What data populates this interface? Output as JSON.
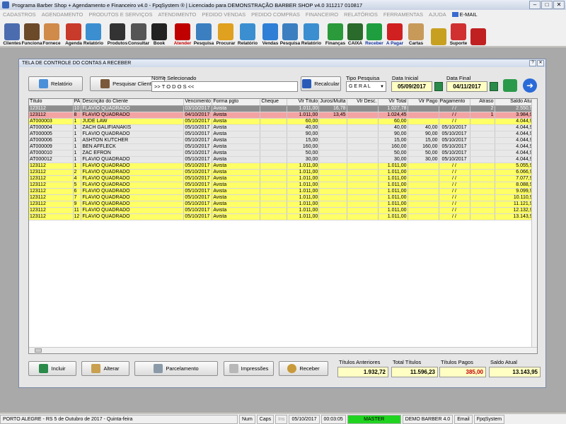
{
  "app": {
    "title": "Programa Barber Shop + Agendamento e Financeiro v4.0 - FpqSystem ® | Licenciado para  DEMONSTRAÇÃO BARBER SHOP v4.0 311217 010817"
  },
  "menu": [
    "CADASTROS",
    "AGENDAMENTO",
    "PRODUTOS E SERVIÇOS",
    "ATENDIMENTO",
    "PEDIDO VENDAS",
    "PEDIDO COMPRAS",
    "FINANCEIRO",
    "RELATÓRIOS",
    "FERRAMENTAS",
    "AJUDA"
  ],
  "menu_email": "E-MAIL",
  "toolbar": [
    {
      "label": "Clientes",
      "icon": "clients-icon",
      "color": "#4b6db0"
    },
    {
      "label": "Funciona",
      "icon": "employee-icon",
      "color": "#6b4a2a"
    },
    {
      "label": "Fornece",
      "icon": "supplier-icon",
      "color": "#d08a4a"
    },
    {
      "label": "Agenda",
      "icon": "schedule-icon",
      "color": "#c83a2a"
    },
    {
      "label": "Relatório",
      "icon": "report-icon",
      "color": "#3b8fd0"
    },
    {
      "label": "Produtos",
      "icon": "products-icon",
      "color": "#333333"
    },
    {
      "label": "Consultar",
      "icon": "consult-icon",
      "color": "#555555"
    },
    {
      "label": "Book",
      "icon": "camera-icon",
      "color": "#222222"
    },
    {
      "label": "Atender",
      "icon": "service-icon",
      "color": "#c00000"
    },
    {
      "label": "Pesquisa",
      "icon": "search-icon",
      "color": "#3b7fc0"
    },
    {
      "label": "Procurar",
      "icon": "folder-icon",
      "color": "#e0a020"
    },
    {
      "label": "Relatório",
      "icon": "report-icon",
      "color": "#3b8fd0"
    },
    {
      "label": "Vendas",
      "icon": "sales-icon",
      "color": "#2f7fd6"
    },
    {
      "label": "Pesquisa",
      "icon": "search-icon",
      "color": "#3b7fc0"
    },
    {
      "label": "Relatório",
      "icon": "report-icon",
      "color": "#3b8fd0"
    },
    {
      "label": "Finanças",
      "icon": "finance-icon",
      "color": "#2a9a3a"
    },
    {
      "label": "CAIXA",
      "icon": "cashbox-icon",
      "color": "#2a6a2a"
    },
    {
      "label": "Receber",
      "icon": "receive-icon",
      "color": "#1e9e3e"
    },
    {
      "label": "A Pagar",
      "icon": "pay-icon",
      "color": "#d02020"
    },
    {
      "label": "Cartas",
      "icon": "letters-icon",
      "color": "#c89a5a"
    },
    {
      "label": "",
      "icon": "coins-icon",
      "color": "#c8a020"
    },
    {
      "label": "Suporte",
      "icon": "support-icon",
      "color": "#d03030"
    },
    {
      "label": "",
      "icon": "exit-icon",
      "color": "#c02020"
    }
  ],
  "window": {
    "title": "TELA DE CONTROLE DO CONTAS A RECEBER",
    "relatorio_btn": "Relatório",
    "pesquisar_btn": "Pesquisar Cliente",
    "nome_label": "Nome Selecionado",
    "nome_value": ">> T O D O S <<",
    "recalcular_btn": "Recalcular",
    "tipo_label": "Tipo  Pesquisa",
    "tipo_value": "G E R A L",
    "data_inicial_label": "Data Inicial",
    "data_inicial": "05/09/2017",
    "data_final_label": "Data Final",
    "data_final": "04/11/2017"
  },
  "grid": {
    "columns": [
      "Título",
      "PA",
      "Descrição do Cliente",
      "Vencimento",
      "Forma pgto",
      "Cheque",
      "Vlr Título",
      "Juros/Multa",
      "Vlr Desc.",
      "Vlr Total",
      "Vlr Pago",
      "Pagamento",
      "Atraso",
      "Saldo Atual"
    ],
    "rows": [
      {
        "style": "gray",
        "cells": [
          "123112",
          "10",
          "FLÁVIO QUADRADO",
          "03/10/2017",
          "Avista",
          "",
          "1.011,00",
          "16,78",
          "",
          "1.027,78",
          "",
          "/  /",
          "2",
          "2.550,50"
        ]
      },
      {
        "style": "pink",
        "cells": [
          "123112",
          "8",
          "FLÁVIO QUADRADO",
          "04/10/2017",
          "Avista",
          "",
          "1.011,00",
          "13,45",
          "",
          "1.024,45",
          "",
          "/  /",
          "1",
          "3.984,95"
        ]
      },
      {
        "style": "yellow",
        "cells": [
          "AT000003",
          "1",
          "JUDE LAW",
          "05/10/2017",
          "Avista",
          "",
          "60,00",
          "",
          "",
          "60,00",
          "",
          "/  /",
          "",
          "4.044,95"
        ]
      },
      {
        "style": "white",
        "cells": [
          "AT000004",
          "1",
          "ZACH GALIFIANAKIS",
          "05/10/2017",
          "Avista",
          "",
          "40,00",
          "",
          "",
          "40,00",
          "40,00",
          "05/10/2017",
          "",
          "4.044,95"
        ]
      },
      {
        "style": "white",
        "cells": [
          "AT000005",
          "1",
          "FLÁVIO QUADRADO",
          "05/10/2017",
          "Avista",
          "",
          "90,00",
          "",
          "",
          "90,00",
          "90,00",
          "05/10/2017",
          "",
          "4.044,95"
        ]
      },
      {
        "style": "white",
        "cells": [
          "AT000006",
          "1",
          "ASHTON KUTCHER",
          "05/10/2017",
          "Avista",
          "",
          "15,00",
          "",
          "",
          "15,00",
          "15,00",
          "05/10/2017",
          "",
          "4.044,95"
        ]
      },
      {
        "style": "white",
        "cells": [
          "AT000009",
          "1",
          "BEN AFFLECK",
          "05/10/2017",
          "Avista",
          "",
          "160,00",
          "",
          "",
          "160,00",
          "160,00",
          "05/10/2017",
          "",
          "4.044,95"
        ]
      },
      {
        "style": "white",
        "cells": [
          "AT000010",
          "1",
          "ZAC EFRON",
          "05/10/2017",
          "Avista",
          "",
          "50,00",
          "",
          "",
          "50,00",
          "50,00",
          "05/10/2017",
          "",
          "4.044,95"
        ]
      },
      {
        "style": "white",
        "cells": [
          "AT000012",
          "1",
          "FLÁVIO QUADRADO",
          "05/10/2017",
          "Avista",
          "",
          "30,00",
          "",
          "",
          "30,00",
          "30,00",
          "05/10/2017",
          "",
          "4.044,95"
        ]
      },
      {
        "style": "yellow",
        "cells": [
          "123112",
          "1",
          "FLÁVIO QUADRADO",
          "05/10/2017",
          "Avista",
          "",
          "1.011,00",
          "",
          "",
          "1.011,00",
          "",
          "/  /",
          "",
          "5.055,95"
        ]
      },
      {
        "style": "yellow",
        "cells": [
          "123112",
          "2",
          "FLÁVIO QUADRADO",
          "05/10/2017",
          "Avista",
          "",
          "1.011,00",
          "",
          "",
          "1.011,00",
          "",
          "/  /",
          "",
          "6.066,95"
        ]
      },
      {
        "style": "yellow",
        "cells": [
          "123112",
          "4",
          "FLÁVIO QUADRADO",
          "05/10/2017",
          "Avista",
          "",
          "1.011,00",
          "",
          "",
          "1.011,00",
          "",
          "/  /",
          "",
          "7.077,95"
        ]
      },
      {
        "style": "yellow",
        "cells": [
          "123112",
          "5",
          "FLÁVIO QUADRADO",
          "05/10/2017",
          "Avista",
          "",
          "1.011,00",
          "",
          "",
          "1.011,00",
          "",
          "/  /",
          "",
          "8.088,95"
        ]
      },
      {
        "style": "yellow",
        "cells": [
          "123112",
          "6",
          "FLÁVIO QUADRADO",
          "05/10/2017",
          "Avista",
          "",
          "1.011,00",
          "",
          "",
          "1.011,00",
          "",
          "/  /",
          "",
          "9.099,95"
        ]
      },
      {
        "style": "yellow",
        "cells": [
          "123112",
          "7",
          "FLÁVIO QUADRADO",
          "05/10/2017",
          "Avista",
          "",
          "1.011,00",
          "",
          "",
          "1.011,00",
          "",
          "/  /",
          "",
          "10.110,95"
        ]
      },
      {
        "style": "yellow",
        "cells": [
          "123112",
          "9",
          "FLÁVIO QUADRADO",
          "05/10/2017",
          "Avista",
          "",
          "1.011,00",
          "",
          "",
          "1.011,00",
          "",
          "/  /",
          "",
          "11.121,95"
        ]
      },
      {
        "style": "yellow",
        "cells": [
          "123112",
          "11",
          "FLÁVIO QUADRADO",
          "05/10/2017",
          "Avista",
          "",
          "1.011,00",
          "",
          "",
          "1.011,00",
          "",
          "/  /",
          "",
          "12.132,95"
        ]
      },
      {
        "style": "yellow",
        "cells": [
          "123112",
          "12",
          "FLÁVIO QUADRADO",
          "05/10/2017",
          "Avista",
          "",
          "1.011,00",
          "",
          "",
          "1.011,00",
          "",
          "/  /",
          "",
          "13.143,95"
        ]
      }
    ]
  },
  "actions": {
    "incluir": "Incluir",
    "alterar": "Alterar",
    "parcelamento": "Parcelamento",
    "impressoes": "Impressões",
    "receber": "Receber"
  },
  "totals": {
    "anteriores_label": "Títulos Anteriores",
    "anteriores": "1.932,72",
    "total_label": "Total Títulos",
    "total": "11.596,23",
    "pagos_label": "Títulos Pagos",
    "pagos": "385,00",
    "saldo_label": "Saldo Atual",
    "saldo": "13.143,95"
  },
  "statusbar": {
    "location": "PORTO ALEGRE - RS   5 de Outubro de 2017 - Quinta-feira",
    "num": "Num",
    "caps": "Caps",
    "ins": "Ins",
    "date": "05/10/2017",
    "time": "00:03:05",
    "master": "MASTER",
    "company": "DEMO BARBER 4.0",
    "email": "Email",
    "brand": "FpqSystem"
  },
  "colors": {
    "gray_row": "#8e8e8e",
    "pink_row": "#f4a3a3",
    "yellow_row": "#ffff66",
    "total_pagos": "#c00000",
    "master": "#21d321"
  }
}
